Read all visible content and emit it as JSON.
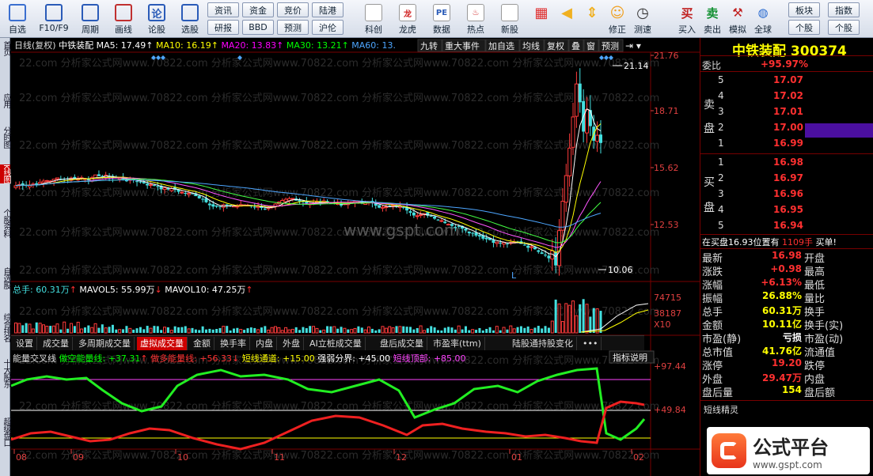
{
  "toolbar": {
    "buttons": [
      {
        "label": "自选",
        "icon": "grid-icon"
      },
      {
        "label": "F10/F9",
        "icon": "f10-icon"
      },
      {
        "label": "周期",
        "icon": "clock-icon"
      },
      {
        "label": "画线",
        "icon": "pencil-icon"
      },
      {
        "label": "论股",
        "icon": "chat-icon"
      },
      {
        "label": "选股",
        "icon": "gauge-icon"
      }
    ],
    "small_buttons": [
      [
        "资讯",
        "研报"
      ],
      [
        "资金",
        "BBD"
      ],
      [
        "竞价",
        "预测"
      ],
      [
        "陆港",
        "沪伦"
      ]
    ],
    "feature_buttons": [
      {
        "label": "科创",
        "icon": "chart-icon"
      },
      {
        "label": "龙虎",
        "icon": "dragon-icon"
      },
      {
        "label": "数据",
        "icon": "pe-icon"
      },
      {
        "label": "热点",
        "icon": "fire-icon"
      },
      {
        "label": "新股",
        "icon": "new-icon"
      }
    ],
    "nav_buttons": [
      {
        "label": "",
        "icon": "color-grid-icon"
      },
      {
        "label": "",
        "icon": "arrow-left-icon"
      },
      {
        "label": "",
        "icon": "arrow-updown-icon"
      },
      {
        "label": "修正",
        "icon": "smile-icon"
      },
      {
        "label": "测速",
        "icon": "stopwatch-icon"
      }
    ],
    "trade_buttons": [
      {
        "label": "买入",
        "icon": "buy-icon",
        "glyph": "买"
      },
      {
        "label": "卖出",
        "icon": "sell-icon",
        "glyph": "卖"
      },
      {
        "label": "模拟",
        "icon": "hammer-icon"
      },
      {
        "label": "全球",
        "icon": "globe-icon"
      }
    ],
    "right_small": [
      [
        "板块",
        "个股"
      ],
      [
        "指数",
        "个股"
      ]
    ]
  },
  "left_tabs": [
    "首页",
    "应用",
    "分时图",
    "K线图",
    "个股资料",
    "自选股",
    "综合排名",
    "十大股东",
    "超级盘口"
  ],
  "chart": {
    "title": "日线(复权)",
    "stock_name": "中铁装配",
    "ma": [
      {
        "label": "MA5: 17.49",
        "color": "#ffffff",
        "arrow": "↑"
      },
      {
        "label": "MA10: 16.19",
        "color": "#ffff00",
        "arrow": "↑"
      },
      {
        "label": "MA20: 13.83",
        "color": "#ff00ff",
        "arrow": "↑"
      },
      {
        "label": "MA30: 13.21",
        "color": "#00ff00",
        "arrow": "↑"
      },
      {
        "label": "MA60: 13.",
        "color": "#4da6ff",
        "arrow": ""
      }
    ],
    "menu": [
      "九转",
      "重大事件",
      "加自选",
      "均线",
      "复权",
      "叠",
      "窗",
      "预测"
    ],
    "price_axis": [
      "21.76",
      "18.71",
      "15.62",
      "12.53"
    ],
    "high_label": "21.14",
    "low_label": "10.06",
    "l_marker": "L",
    "volume_title": "总手: 60.31万",
    "mavol5": "MAVOL5: 55.99万",
    "mavol10": "MAVOL10: 47.25万",
    "volume_axis": [
      "74715",
      "38187",
      "X10"
    ],
    "tabs": [
      "设置",
      "成交量",
      "多周期成交量",
      "虚拟成交量",
      "金额",
      "换手率",
      "内盘",
      "外盘",
      "AI立桩成交量",
      "盘后成交量",
      "市盈率(ttm)",
      "陆股通持股变化",
      "•••"
    ],
    "active_tab": "虚拟成交量",
    "indicator": {
      "name": "能量交叉线",
      "items": [
        {
          "label": "做空能量线: +37.31",
          "color": "#00ff00",
          "arrow": "↑"
        },
        {
          "label": "做多能量线: +56.33",
          "color": "#ff3030",
          "arrow": "↓"
        },
        {
          "label": "短线通道: +15.00",
          "color": "#ffff00",
          "arrow": ""
        },
        {
          "label": "强弱分界: +45.00",
          "color": "#ffffff",
          "arrow": ""
        },
        {
          "label": "短线顶部: +85.00",
          "color": "#ff44ff",
          "arrow": ""
        }
      ],
      "help": "指标说明",
      "axis": [
        "+97.44",
        "+49.84"
      ]
    },
    "months": [
      "08",
      "09",
      "10",
      "11",
      "12",
      "01",
      "02"
    ],
    "watermarks": [
      "22.com 分析家公式网www.70822.com 分析家公式网www.70822.com 分析家公式网www.70822.com 分析家公式网www.70822.com",
      "www.gspt.com"
    ]
  },
  "right_panel": {
    "header": "中铁装配 300374",
    "webi_label": "委比",
    "webi_value": "+95.97%",
    "sell_label": [
      "卖",
      "盘"
    ],
    "buy_label": [
      "买",
      "盘"
    ],
    "sell": [
      {
        "n": "5",
        "price": "17.07"
      },
      {
        "n": "4",
        "price": "17.02"
      },
      {
        "n": "3",
        "price": "17.01"
      },
      {
        "n": "2",
        "price": "17.00"
      },
      {
        "n": "1",
        "price": "16.99"
      }
    ],
    "buy": [
      {
        "n": "1",
        "price": "16.98"
      },
      {
        "n": "2",
        "price": "16.97"
      },
      {
        "n": "3",
        "price": "16.96"
      },
      {
        "n": "4",
        "price": "16.95"
      },
      {
        "n": "5",
        "price": "16.94"
      }
    ],
    "notice": "在买盘16.93位置有",
    "notice_qty": "1109手",
    "notice_tail": "买单!",
    "stats": [
      {
        "k": "最新",
        "v": "16.98",
        "k2": "开盘",
        "color": "#ff3030"
      },
      {
        "k": "涨跌",
        "v": "+0.98",
        "k2": "最高",
        "color": "#ff3030"
      },
      {
        "k": "涨幅",
        "v": "+6.13%",
        "k2": "最低",
        "color": "#ff3030"
      },
      {
        "k": "振幅",
        "v": "26.88%",
        "k2": "量比",
        "color": "#ffff00"
      },
      {
        "k": "总手",
        "v": "60.31万",
        "k2": "换手",
        "color": "#ffff00"
      },
      {
        "k": "金额",
        "v": "10.11亿",
        "k2": "换手(实)",
        "color": "#ffff00"
      },
      {
        "k": "市盈(静)",
        "v": "亏损",
        "k2": "市盈(动)",
        "color": "#ffffff"
      },
      {
        "k": "总市值",
        "v": "41.76亿",
        "k2": "流通值",
        "color": "#ffff00"
      },
      {
        "k": "涨停",
        "v": "19.20",
        "k2": "跌停",
        "color": "#ff3030"
      },
      {
        "k": "外盘",
        "v": "29.47万",
        "k2": "内盘",
        "color": "#ff3030"
      },
      {
        "k": "盘后量",
        "v": "154",
        "k2": "盘后额",
        "color": "#ffff00"
      }
    ],
    "jingling": "短线精灵"
  },
  "logo": {
    "name": "公式平台",
    "url": "www.gspt.com"
  }
}
